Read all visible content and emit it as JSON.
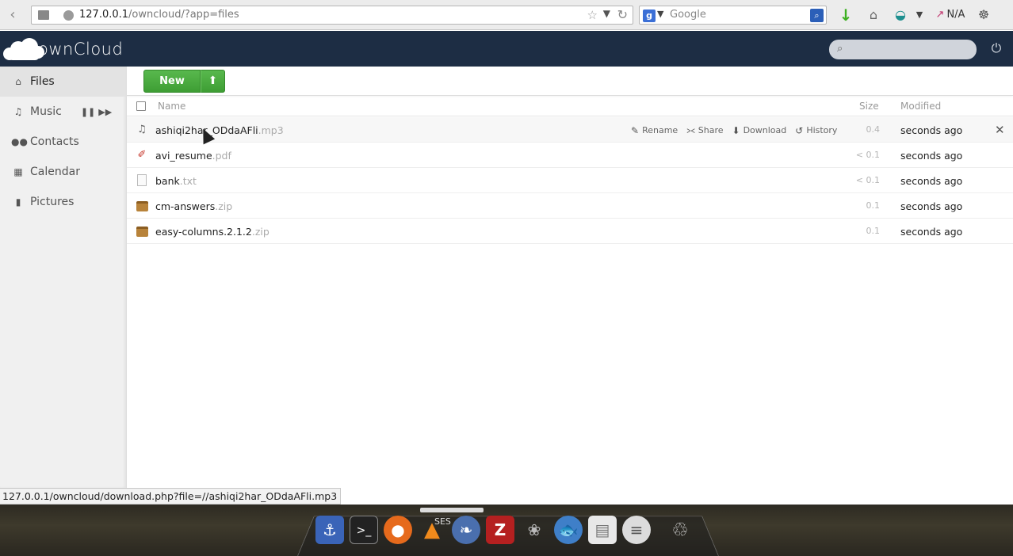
{
  "browser": {
    "url_host": "127.0.0.1",
    "url_path": "/owncloud/?app=files",
    "search_placeholder": "Google",
    "engine_letter": "g",
    "toolbar_badge": "N/A"
  },
  "header": {
    "brand": "ownCloud"
  },
  "sidebar": {
    "items": [
      {
        "label": "Files",
        "icon": "home-icon",
        "active": true
      },
      {
        "label": "Music",
        "icon": "music-note-icon"
      },
      {
        "label": "Contacts",
        "icon": "people-icon"
      },
      {
        "label": "Calendar",
        "icon": "calendar-icon"
      },
      {
        "label": "Pictures",
        "icon": "picture-icon"
      }
    ]
  },
  "controls": {
    "new_label": "New",
    "upload_icon": "upload-arrow-icon"
  },
  "table": {
    "headers": {
      "name": "Name",
      "size": "Size",
      "modified": "Modified"
    },
    "actions": {
      "rename": "Rename",
      "share": "Share",
      "download": "Download",
      "history": "History"
    },
    "rows": [
      {
        "base": "ashiqi2har_ODdaAFli",
        "ext": ".mp3",
        "size": "0.4",
        "modified": "seconds ago",
        "type": "audio"
      },
      {
        "base": "avi_resume",
        "ext": ".pdf",
        "size": "< 0.1",
        "modified": "seconds ago",
        "type": "pdf"
      },
      {
        "base": "bank",
        "ext": ".txt",
        "size": "< 0.1",
        "modified": "seconds ago",
        "type": "text"
      },
      {
        "base": "cm-answers",
        "ext": ".zip",
        "size": "0.1",
        "modified": "seconds ago",
        "type": "zip"
      },
      {
        "base": "easy-columns.2.1.2",
        "ext": ".zip",
        "size": "0.1",
        "modified": "seconds ago",
        "type": "zip"
      }
    ]
  },
  "statusbar": {
    "text": "127.0.0.1/owncloud/download.php?file=//ashiqi2har_ODdaAFli.mp3"
  },
  "dock": {
    "label": "SES"
  },
  "colors": {
    "header_bg": "#1d2d44",
    "new_button": "#4aa83f",
    "sidebar_bg": "#f0f0f0"
  }
}
